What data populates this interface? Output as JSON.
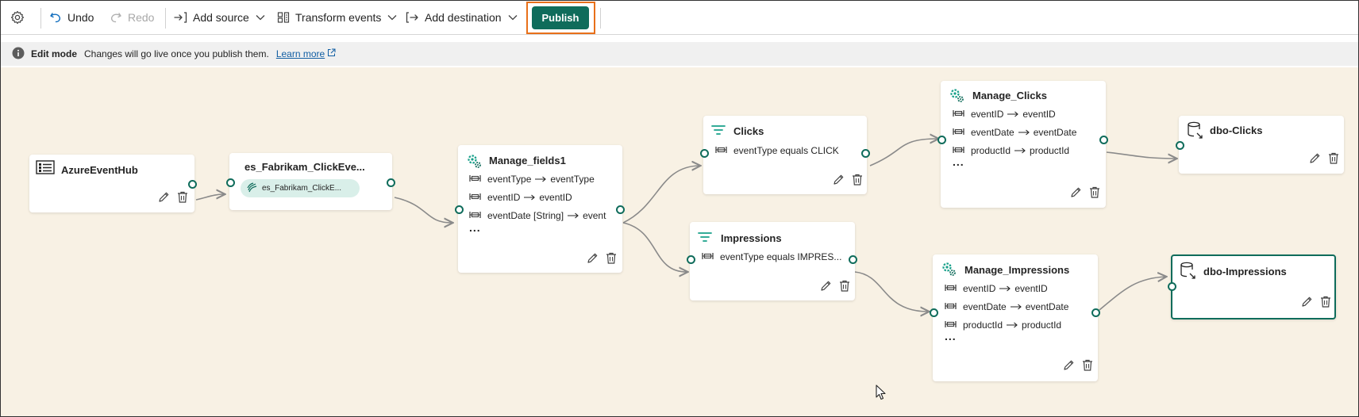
{
  "toolbar": {
    "undo": "Undo",
    "redo": "Redo",
    "add_source": "Add source",
    "transform_events": "Transform events",
    "add_destination": "Add destination",
    "publish": "Publish"
  },
  "banner": {
    "mode": "Edit mode",
    "message": "Changes will go live once you publish them.",
    "link": "Learn more"
  },
  "nodes": {
    "azure": {
      "title": "AzureEventHub"
    },
    "stream": {
      "title": "es_Fabrikam_ClickEve...",
      "chip": "es_Fabrikam_ClickE..."
    },
    "manage_fields": {
      "title": "Manage_fields1",
      "rows": [
        {
          "from": "eventType",
          "to": "eventType"
        },
        {
          "from": "eventID",
          "to": "eventID"
        },
        {
          "from": "eventDate [String]",
          "to": "event"
        }
      ],
      "more": "..."
    },
    "clicks": {
      "title": "Clicks",
      "condition": "eventType equals CLICK"
    },
    "impressions": {
      "title": "Impressions",
      "condition": "eventType equals IMPRES..."
    },
    "manage_clicks": {
      "title": "Manage_Clicks",
      "rows": [
        {
          "from": "eventID",
          "to": "eventID"
        },
        {
          "from": "eventDate",
          "to": "eventDate"
        },
        {
          "from": "productId",
          "to": "productId"
        }
      ],
      "more": "..."
    },
    "manage_impressions": {
      "title": "Manage_Impressions",
      "rows": [
        {
          "from": "eventID",
          "to": "eventID"
        },
        {
          "from": "eventDate",
          "to": "eventDate"
        },
        {
          "from": "productId",
          "to": "productId"
        }
      ],
      "more": "..."
    },
    "dbo_clicks": {
      "title": "dbo-Clicks"
    },
    "dbo_impressions": {
      "title": "dbo-Impressions"
    }
  },
  "colors": {
    "accent": "#0f6c5b",
    "publish_outline": "#e8701a",
    "canvas": "#f8f1e4",
    "banner": "#f0f0f0"
  },
  "icons": [
    "settings-icon",
    "undo-icon",
    "redo-icon",
    "add-source-icon",
    "transform-icon",
    "add-destination-icon",
    "chevron-down-icon",
    "info-icon",
    "external-link-icon",
    "event-hub-icon",
    "eventstream-icon",
    "manage-fields-icon",
    "filter-icon",
    "field-map-icon",
    "database-icon",
    "edit-icon",
    "delete-icon"
  ]
}
